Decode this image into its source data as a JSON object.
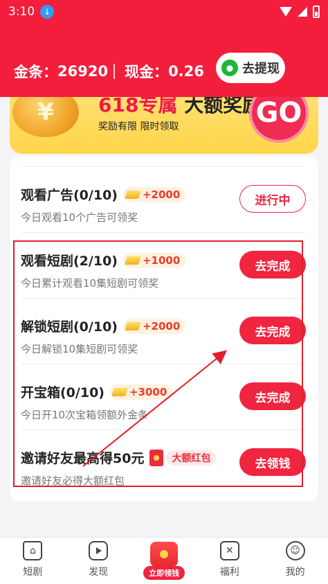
{
  "status_bar": {
    "time": "3:10"
  },
  "header": {
    "gold_label": "金条：",
    "gold_value": "26920",
    "cash_label": "现金：",
    "cash_value": "0.26",
    "withdraw_label": "去提现"
  },
  "banner": {
    "title_red": "618专属",
    "title_dark": "大额奖励",
    "subtitle": "奖励有限  限时领取",
    "go_label": "GO",
    "coin_symbol": "¥"
  },
  "tasks": [
    {
      "title": "观看广告(0/10)",
      "reward": "+2000",
      "desc": "今日观看10个广告可领奖",
      "button": "进行中"
    },
    {
      "title": "观看短剧(2/10)",
      "reward": "+1000",
      "desc": "今日累计观看10集短剧可领奖",
      "button": "去完成"
    },
    {
      "title": "解锁短剧(0/10)",
      "reward": "+2000",
      "desc": "今日解锁10集短剧可领奖",
      "button": "去完成"
    },
    {
      "title": "开宝箱(0/10)",
      "reward": "+3000",
      "desc": "今日开10次宝箱领额外金条",
      "button": "去完成"
    },
    {
      "title": "邀请好友最高得50元",
      "tag": "大额红包",
      "desc": "邀请好友必得大额红包",
      "button": "去领钱"
    }
  ],
  "bottom_nav": [
    {
      "label": "短剧",
      "icon": "home-icon"
    },
    {
      "label": "发现",
      "icon": "play-icon"
    },
    {
      "label": "立即领钱",
      "icon": "red-envelope-icon"
    },
    {
      "label": "福利",
      "icon": "gift-icon"
    },
    {
      "label": "我的",
      "icon": "profile-icon"
    }
  ],
  "colors": {
    "brand_red": "#f21e3c",
    "button_red": "#f0253f",
    "banner_yellow": "#ffd54a",
    "highlight_red": "#e01f2a"
  }
}
